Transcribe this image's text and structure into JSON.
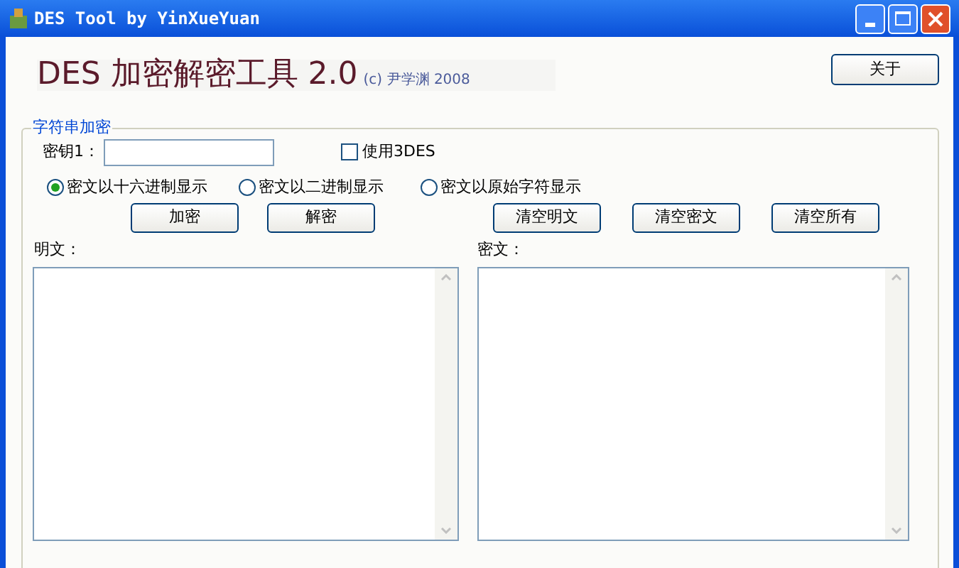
{
  "window": {
    "title": "DES Tool by YinXueYuan"
  },
  "header": {
    "title": "DES 加密解密工具 2.0",
    "credit": "(c) 尹学渊 2008",
    "about_button": "关于"
  },
  "group": {
    "legend": "字符串加密",
    "key_label": "密钥1：",
    "use_3des": {
      "label": "使用3DES",
      "checked": false
    },
    "display_modes": [
      {
        "label": "密文以十六进制显示",
        "selected": true
      },
      {
        "label": "密文以二进制显示",
        "selected": false
      },
      {
        "label": "密文以原始字符显示",
        "selected": false
      }
    ],
    "left_buttons": [
      "加密",
      "解密"
    ],
    "right_buttons": [
      "清空明文",
      "清空密文",
      "清空所有"
    ],
    "plaintext_label": "明文：",
    "ciphertext_label": "密文："
  }
}
